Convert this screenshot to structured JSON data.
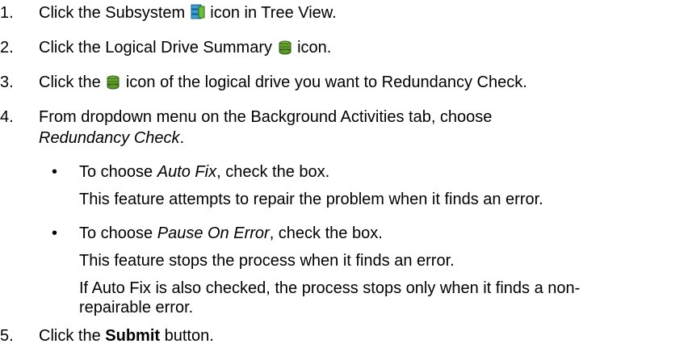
{
  "steps": [
    {
      "num": "1.",
      "pre": "Click the Subsystem",
      "icon": "subsystem-icon",
      "post": "icon in Tree View."
    },
    {
      "num": "2.",
      "pre": "Click the Logical Drive Summary",
      "icon": "logical-drive-summary-icon",
      "post": "icon."
    },
    {
      "num": "3.",
      "pre": "Click the",
      "icon": "logical-drive-icon",
      "post": "icon of the logical drive you want to Redundancy Check."
    },
    {
      "num": "4.",
      "line1": "From dropdown menu on the Background Activities tab, choose",
      "line2_em": "Redundancy Check",
      "line2_post": "."
    },
    {
      "num": "5.",
      "pre": "Click the",
      "bold": "Submit",
      "post": "button."
    }
  ],
  "bullets": [
    {
      "symbol": "•",
      "pre": "To choose",
      "em": "Auto Fix",
      "post": ", check the box.",
      "desc": "This feature attempts to repair the problem when it finds an error."
    },
    {
      "symbol": "•",
      "pre": "To choose",
      "em": "Pause On Error",
      "post": ", check the box.",
      "desc": "This feature stops the process when it finds an error.",
      "note1": "If Auto Fix is also checked, the process stops only when it finds a non-",
      "note2": "repairable error."
    }
  ]
}
